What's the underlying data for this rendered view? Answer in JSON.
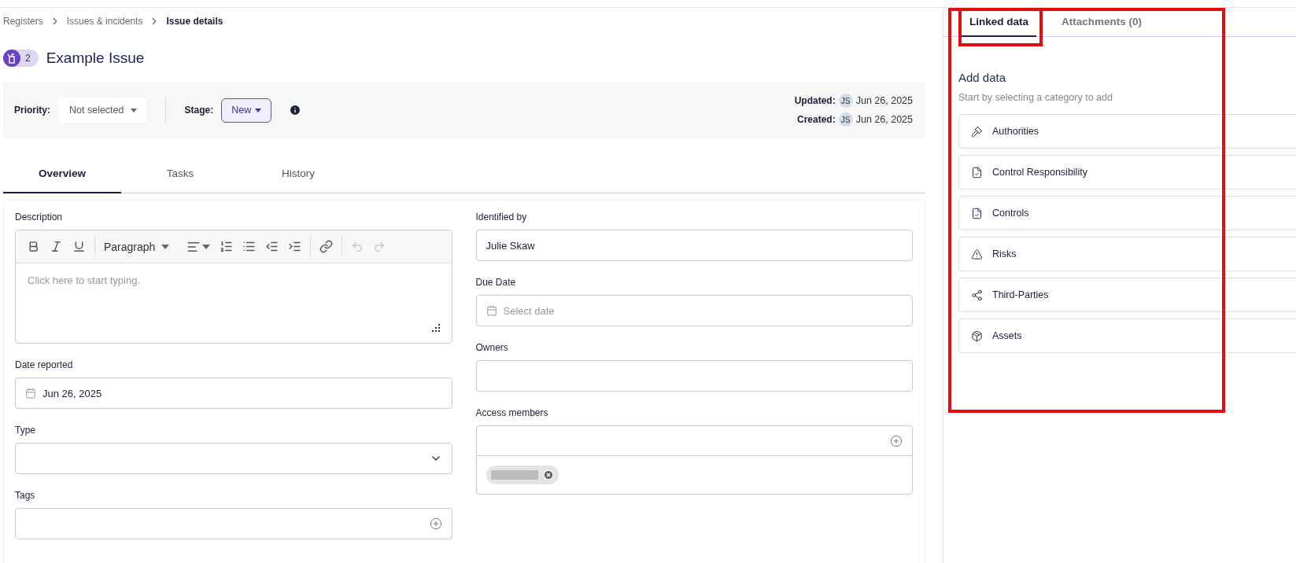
{
  "breadcrumb": [
    {
      "label": "Registers",
      "selected": false
    },
    {
      "label": "Issues & incidents",
      "selected": false
    },
    {
      "label": "Issue details",
      "selected": true
    }
  ],
  "issue": {
    "count": "2",
    "title": "Example Issue"
  },
  "header": {
    "priority": {
      "label": "Priority:",
      "value": "Not selected"
    },
    "stage": {
      "label": "Stage:",
      "value": "New"
    },
    "meta": [
      {
        "label": "Updated:",
        "initials": "JS",
        "date": "Jun 26, 2025"
      },
      {
        "label": "Created:",
        "initials": "JS",
        "date": "Jun 26, 2025"
      }
    ]
  },
  "tabs": [
    {
      "label": "Overview",
      "selected": true
    },
    {
      "label": "Tasks",
      "selected": false
    },
    {
      "label": "History",
      "selected": false
    }
  ],
  "editor": {
    "label": "Description",
    "format": "Paragraph",
    "placeholder": "Click here to start typing.",
    "history_disabled": true
  },
  "fields_left": [
    {
      "kind": "date",
      "label": "Date reported",
      "value": "Jun 26, 2025"
    },
    {
      "kind": "select",
      "label": "Type"
    },
    {
      "kind": "tags",
      "label": "Tags"
    }
  ],
  "fields_right": [
    {
      "kind": "text",
      "label": "Identified by",
      "value": "Julie Skaw"
    },
    {
      "kind": "date",
      "label": "Due Date",
      "placeholder": "Select date"
    },
    {
      "kind": "text",
      "label": "Owners"
    },
    {
      "kind": "members",
      "label": "Access members",
      "chips": [
        {
          "kind": "redacted"
        }
      ]
    }
  ],
  "side_panel": {
    "highlighted": true,
    "tabs": [
      {
        "label": "Linked data",
        "selected": true,
        "highlighted": true
      },
      {
        "label": "Attachments (0)",
        "selected": false,
        "highlighted": false
      }
    ],
    "title": "Add data",
    "subtitle": "Start by selecting a category to add",
    "categories": [
      {
        "kind": "authorities",
        "label": "Authorities"
      },
      {
        "kind": "document",
        "label": "Control Responsibility"
      },
      {
        "kind": "document",
        "label": "Controls"
      },
      {
        "kind": "warning",
        "label": "Risks"
      },
      {
        "kind": "network",
        "label": "Third-Parties"
      },
      {
        "kind": "box",
        "label": "Assets"
      }
    ]
  }
}
